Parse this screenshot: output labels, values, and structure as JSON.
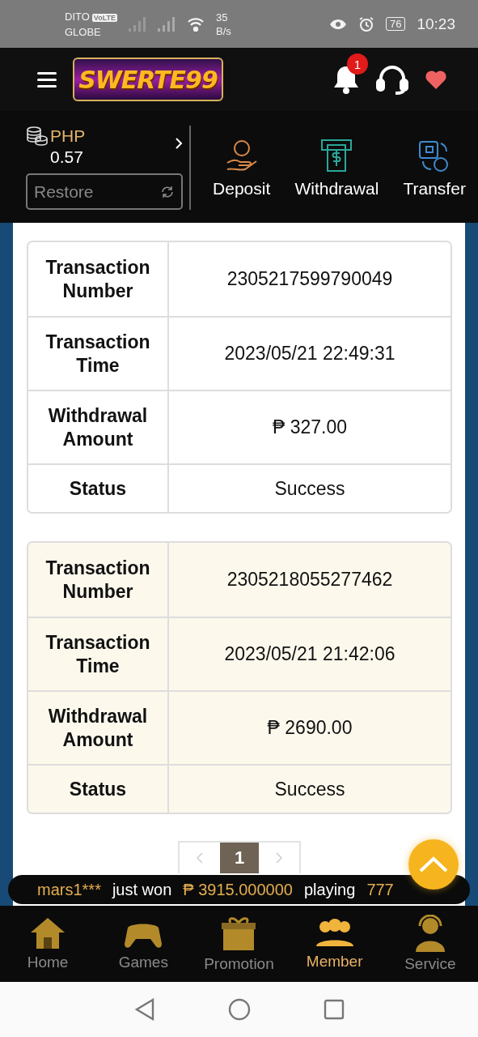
{
  "status_bar": {
    "carrier_1": "DITO",
    "volte": "VoLTE",
    "carrier_2": "GLOBE",
    "speed_value": "35",
    "speed_unit": "B/s",
    "battery": "76",
    "time": "10:23"
  },
  "header": {
    "logo": "SWERTE99",
    "notification_count": "1"
  },
  "wallet": {
    "currency": "PHP",
    "balance": "0.57",
    "restore": "Restore",
    "actions": [
      {
        "kind": "deposit",
        "label": "Deposit"
      },
      {
        "kind": "withdrawal",
        "label": "Withdrawal"
      },
      {
        "kind": "transfer",
        "label": "Transfer"
      }
    ]
  },
  "transactions": [
    {
      "highlighted": false,
      "fields": [
        {
          "label": "Transaction Number",
          "value": "2305217599790049"
        },
        {
          "label": "Transaction Time",
          "value": "2023/05/21 22:49:31"
        },
        {
          "label": "Withdrawal Amount",
          "value": "₱ 327.00"
        },
        {
          "label": "Status",
          "value": "Success"
        }
      ]
    },
    {
      "highlighted": true,
      "fields": [
        {
          "label": "Transaction Number",
          "value": "2305218055277462"
        },
        {
          "label": "Transaction Time",
          "value": "2023/05/21 21:42:06"
        },
        {
          "label": "Withdrawal Amount",
          "value": "₱ 2690.00"
        },
        {
          "label": "Status",
          "value": "Success"
        }
      ]
    }
  ],
  "pagination": {
    "pages": [
      {
        "label": "1",
        "selected": true
      }
    ]
  },
  "ticker": {
    "user": "mars1***",
    "text_1": "just won",
    "amount": "₱ 3915.000000",
    "text_2": "playing",
    "game": "777"
  },
  "nav": [
    {
      "kind": "home",
      "label": "Home",
      "selected": false
    },
    {
      "kind": "games",
      "label": "Games",
      "selected": false
    },
    {
      "kind": "promotion",
      "label": "Promotion",
      "selected": false
    },
    {
      "kind": "member",
      "label": "Member",
      "selected": true
    },
    {
      "kind": "service",
      "label": "Service",
      "selected": false
    }
  ]
}
